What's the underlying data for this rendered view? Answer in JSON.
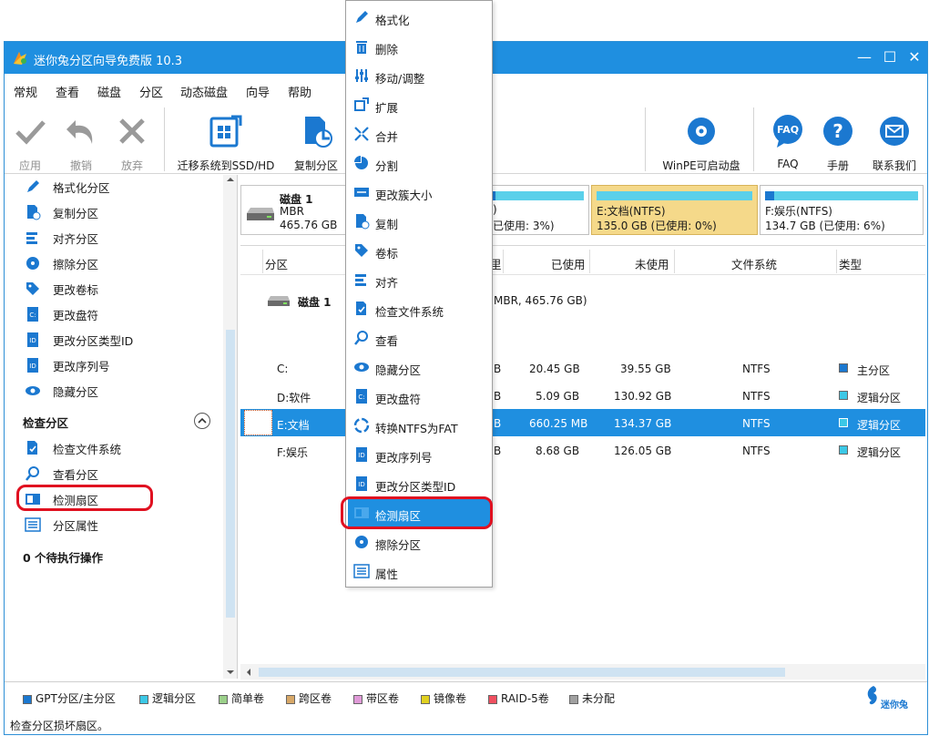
{
  "window": {
    "title": "迷你兔分区向导免费版 10.3"
  },
  "menubar": [
    "常规",
    "查看",
    "磁盘",
    "分区",
    "动态磁盘",
    "向导",
    "帮助"
  ],
  "toolbar": {
    "apply": "应用",
    "undo": "撤销",
    "discard": "放弃",
    "migrate": "迁移系统到SSD/HD",
    "copy_partition": "复制分区",
    "winpe": "WinPE可启动盘",
    "faq": "FAQ",
    "manual": "手册",
    "contact": "联系我们"
  },
  "left_panel": {
    "ops": [
      "格式化分区",
      "复制分区",
      "对齐分区",
      "擦除分区",
      "更改卷标",
      "更改盘符",
      "更改分区类型ID",
      "更改序列号",
      "隐藏分区"
    ],
    "check_section": "检查分区",
    "check_ops": [
      "检查文件系统",
      "查看分区",
      "检测扇区",
      "分区属性"
    ],
    "pending": "0 个待执行操作"
  },
  "disk_map": {
    "disk_name": "磁盘 1",
    "disk_type": "MBR",
    "disk_size": "465.76 GB",
    "blocks": [
      {
        "line1": ")",
        "line2": "已使用: 3%)",
        "used_pct": 3
      },
      {
        "line1": "E:文档(NTFS)",
        "line2": "135.0 GB (已使用: 0%)",
        "used_pct": 0
      },
      {
        "line1": "F:娱乐(NTFS)",
        "line2": "134.7 GB (已使用: 6%)",
        "used_pct": 6
      }
    ]
  },
  "table": {
    "headers": {
      "partition": "分区",
      "capacity_tail": "里",
      "used": "已使用",
      "unused": "未使用",
      "filesystem": "文件系统",
      "type": "类型"
    },
    "disk_row": {
      "name": "磁盘 1",
      "paren": "(",
      "info": "MBR, 465.76 GB)"
    },
    "rows": [
      {
        "partition": "C:",
        "cap_tail": "B",
        "used": "20.45 GB",
        "unused": "39.55 GB",
        "fs": "NTFS",
        "type": "主分区",
        "color": "#1b78d0"
      },
      {
        "partition": "D:软件",
        "cap_tail": "B",
        "used": "5.09 GB",
        "unused": "130.92 GB",
        "fs": "NTFS",
        "type": "逻辑分区",
        "color": "#3cc8e6"
      },
      {
        "partition": "E:文档",
        "cap_tail": "B",
        "used": "660.25 MB",
        "unused": "134.37 GB",
        "fs": "NTFS",
        "type": "逻辑分区",
        "color": "#3cc8e6"
      },
      {
        "partition": "F:娱乐",
        "cap_tail": "B",
        "used": "8.68 GB",
        "unused": "126.05 GB",
        "fs": "NTFS",
        "type": "逻辑分区",
        "color": "#3cc8e6"
      }
    ]
  },
  "legend": [
    {
      "label": "GPT分区/主分区",
      "color": "#1b78d0"
    },
    {
      "label": "逻辑分区",
      "color": "#3cc8e6"
    },
    {
      "label": "简单卷",
      "color": "#9bd08a"
    },
    {
      "label": "跨区卷",
      "color": "#d8a868"
    },
    {
      "label": "带区卷",
      "color": "#e09ad8"
    },
    {
      "label": "镜像卷",
      "color": "#e0d020"
    },
    {
      "label": "RAID-5卷",
      "color": "#f05060"
    },
    {
      "label": "未分配",
      "color": "#a0a0a0"
    }
  ],
  "brand": "迷你兔",
  "status": "检查分区损坏扇区。",
  "context_menu": [
    "格式化",
    "删除",
    "移动/调整",
    "扩展",
    "合并",
    "分割",
    "更改簇大小",
    "复制",
    "卷标",
    "对齐",
    "检查文件系统",
    "查看",
    "隐藏分区",
    "更改盘符",
    "转换NTFS为FAT",
    "更改序列号",
    "更改分区类型ID",
    "检测扇区",
    "擦除分区",
    "属性"
  ],
  "colors": {
    "accent": "#1f8fe0",
    "highlight_red": "#e01020",
    "selected_block": "#f5d98a"
  }
}
